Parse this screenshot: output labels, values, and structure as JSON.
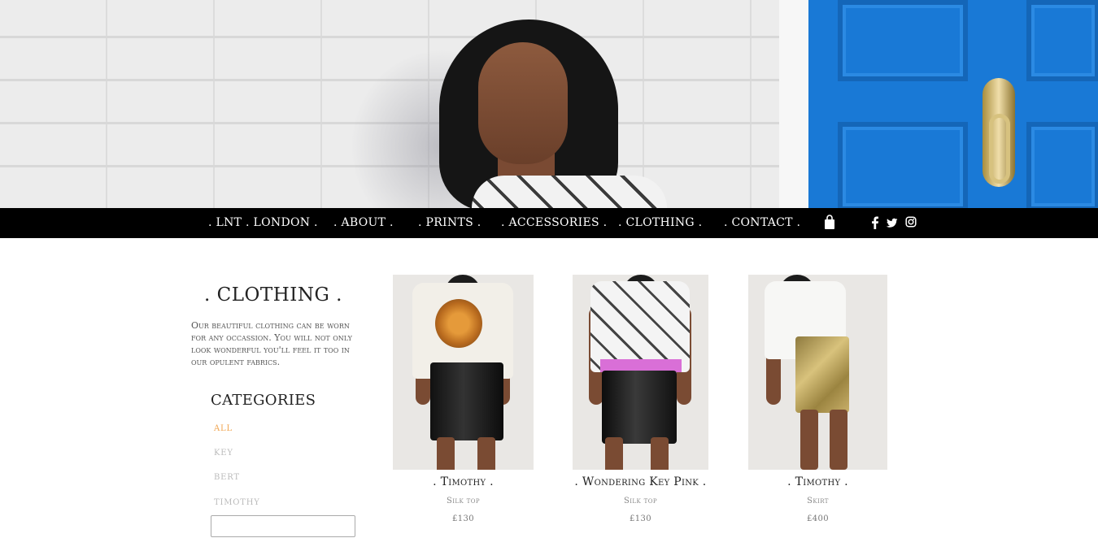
{
  "nav": {
    "items": [
      ". LNT . LONDON .",
      ". ABOUT .",
      ". PRINTS .",
      ". ACCESSORIES .",
      ". CLOTHING .",
      ". CONTACT ."
    ],
    "icons": [
      "shopping-bag-icon",
      "facebook-icon",
      "twitter-icon",
      "instagram-icon"
    ]
  },
  "sidebar": {
    "title": ". CLOTHING .",
    "intro": "Our beautiful clothing can be worn for any occassion. You will not only look wonderful you'll feel it too in our opulent fabrics.",
    "categories_title": "CATEGORIES",
    "categories": [
      "ALL",
      "KEY",
      "BERT",
      "TIMOTHY"
    ],
    "active_category": "ALL",
    "accent_color": "#f0a44f"
  },
  "products": [
    {
      "name": ". Timothy .",
      "type": "Silk top",
      "price": "£130"
    },
    {
      "name": ". Wondering Key Pink .",
      "type": "Silk top",
      "price": "£130"
    },
    {
      "name": ". Timothy .",
      "type": "Skirt",
      "price": "£400"
    }
  ]
}
